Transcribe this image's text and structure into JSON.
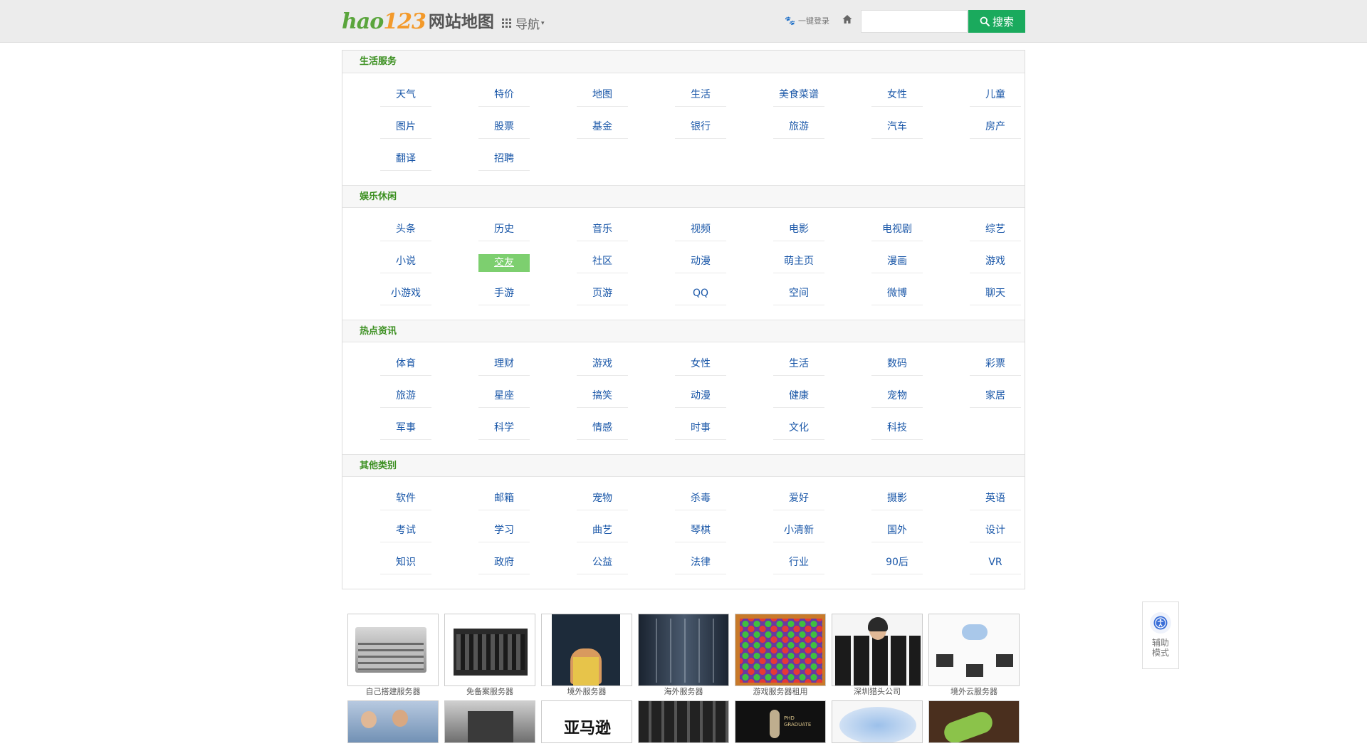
{
  "header": {
    "logo_hao": "hao",
    "logo_num": "123",
    "logo_sub": "网站地图",
    "nav_label": "导航",
    "login_label": "一键登录",
    "search_placeholder": "",
    "search_button": "搜索",
    "accent": "#1aaa5d"
  },
  "sections": [
    {
      "title": "生活服务",
      "links": [
        "天气",
        "特价",
        "地图",
        "生活",
        "美食菜谱",
        "女性",
        "儿童",
        "图片",
        "股票",
        "基金",
        "银行",
        "旅游",
        "汽车",
        "房产",
        "翻译",
        "招聘"
      ]
    },
    {
      "title": "娱乐休闲",
      "links": [
        "头条",
        "历史",
        "音乐",
        "视频",
        "电影",
        "电视剧",
        "综艺",
        "小说",
        "交友",
        "社区",
        "动漫",
        "萌主页",
        "漫画",
        "游戏",
        "小游戏",
        "手游",
        "页游",
        "QQ",
        "空间",
        "微博",
        "聊天"
      ],
      "active": "交友"
    },
    {
      "title": "热点资讯",
      "links": [
        "体育",
        "理财",
        "游戏",
        "女性",
        "生活",
        "数码",
        "彩票",
        "旅游",
        "星座",
        "搞笑",
        "动漫",
        "健康",
        "宠物",
        "家居",
        "军事",
        "科学",
        "情感",
        "时事",
        "文化",
        "科技"
      ]
    },
    {
      "title": "其他类别",
      "links": [
        "软件",
        "邮箱",
        "宠物",
        "杀毒",
        "爱好",
        "摄影",
        "英语",
        "考试",
        "学习",
        "曲艺",
        "琴棋",
        "小清新",
        "国外",
        "设计",
        "知识",
        "政府",
        "公益",
        "法律",
        "行业",
        "90后",
        "VR"
      ]
    }
  ],
  "ads": {
    "row1": [
      "自己搭建服务器",
      "免备案服务器",
      "境外服务器",
      "海外服务器",
      "游戏服务器租用",
      "深圳猎头公司",
      "境外云服务器"
    ],
    "row2_text": [
      "亚马逊",
      "PHD GRADUATE"
    ]
  },
  "a11y": {
    "label": "辅助模式"
  }
}
